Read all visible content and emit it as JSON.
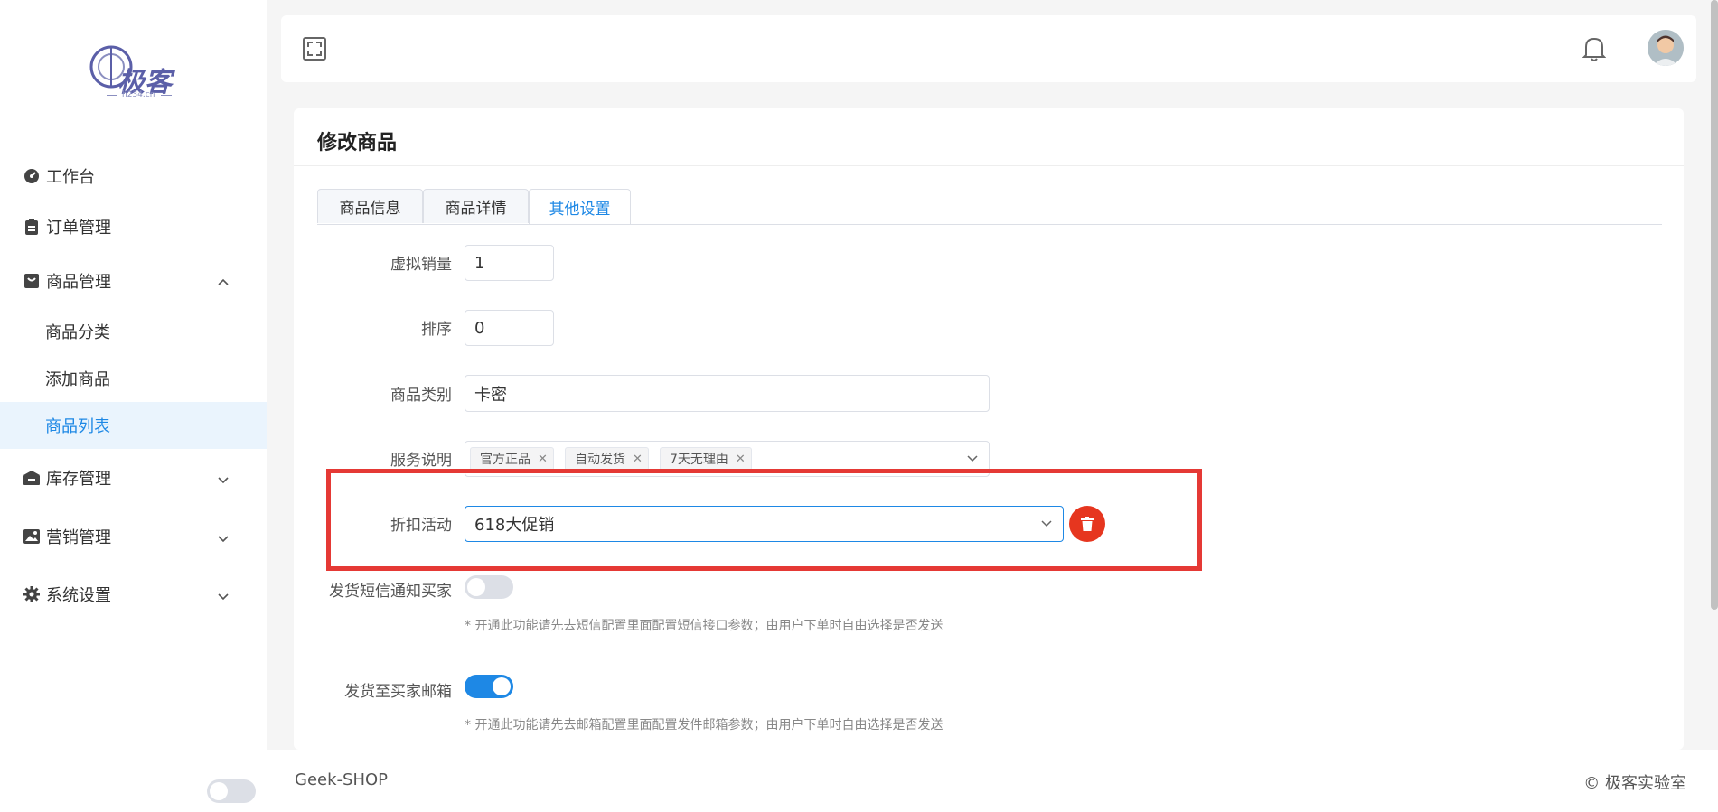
{
  "sidebar": {
    "logo": {
      "text": "极客",
      "sub": "h234.cn"
    },
    "items": [
      {
        "label": "工作台",
        "icon": "dashboard-icon"
      },
      {
        "label": "订单管理",
        "icon": "clipboard-icon"
      },
      {
        "label": "商品管理",
        "icon": "shopping-bag-icon",
        "expanded": true
      },
      {
        "label": "库存管理",
        "icon": "warehouse-icon"
      },
      {
        "label": "营销管理",
        "icon": "image-icon"
      },
      {
        "label": "系统设置",
        "icon": "gear-icon"
      }
    ],
    "sub_items": [
      {
        "label": "商品分类"
      },
      {
        "label": "添加商品"
      },
      {
        "label": "商品列表",
        "active": true
      }
    ]
  },
  "header": {
    "expand_icon": "fullscreen-icon",
    "bell_icon": "bell-icon",
    "avatar": "avatar"
  },
  "page": {
    "title": "修改商品",
    "tabs": [
      {
        "label": "商品信息"
      },
      {
        "label": "商品详情"
      },
      {
        "label": "其他设置",
        "active": true
      }
    ]
  },
  "form": {
    "virtual_sales": {
      "label": "虚拟销量",
      "value": "1"
    },
    "sort": {
      "label": "排序",
      "value": "0"
    },
    "category": {
      "label": "商品类别",
      "value": "卡密"
    },
    "service": {
      "label": "服务说明",
      "tags": [
        "官方正品",
        "自动发货",
        "7天无理由"
      ]
    },
    "discount": {
      "label": "折扣活动",
      "value": "618大促销"
    },
    "sms_notify": {
      "label": "发货短信通知买家",
      "enabled": false,
      "hint": "* 开通此功能请先去短信配置里面配置短信接口参数；由用户下单时自由选择是否发送"
    },
    "email_notify": {
      "label": "发货至买家邮箱",
      "enabled": true,
      "hint": "* 开通此功能请先去邮箱配置里面配置发件邮箱参数；由用户下单时自由选择是否发送"
    }
  },
  "footer": {
    "left": "Geek-SHOP",
    "right": "© 极客实验室"
  },
  "colors": {
    "accent": "#1e88e5",
    "danger": "#e6361f",
    "highlight": "#e53935"
  }
}
